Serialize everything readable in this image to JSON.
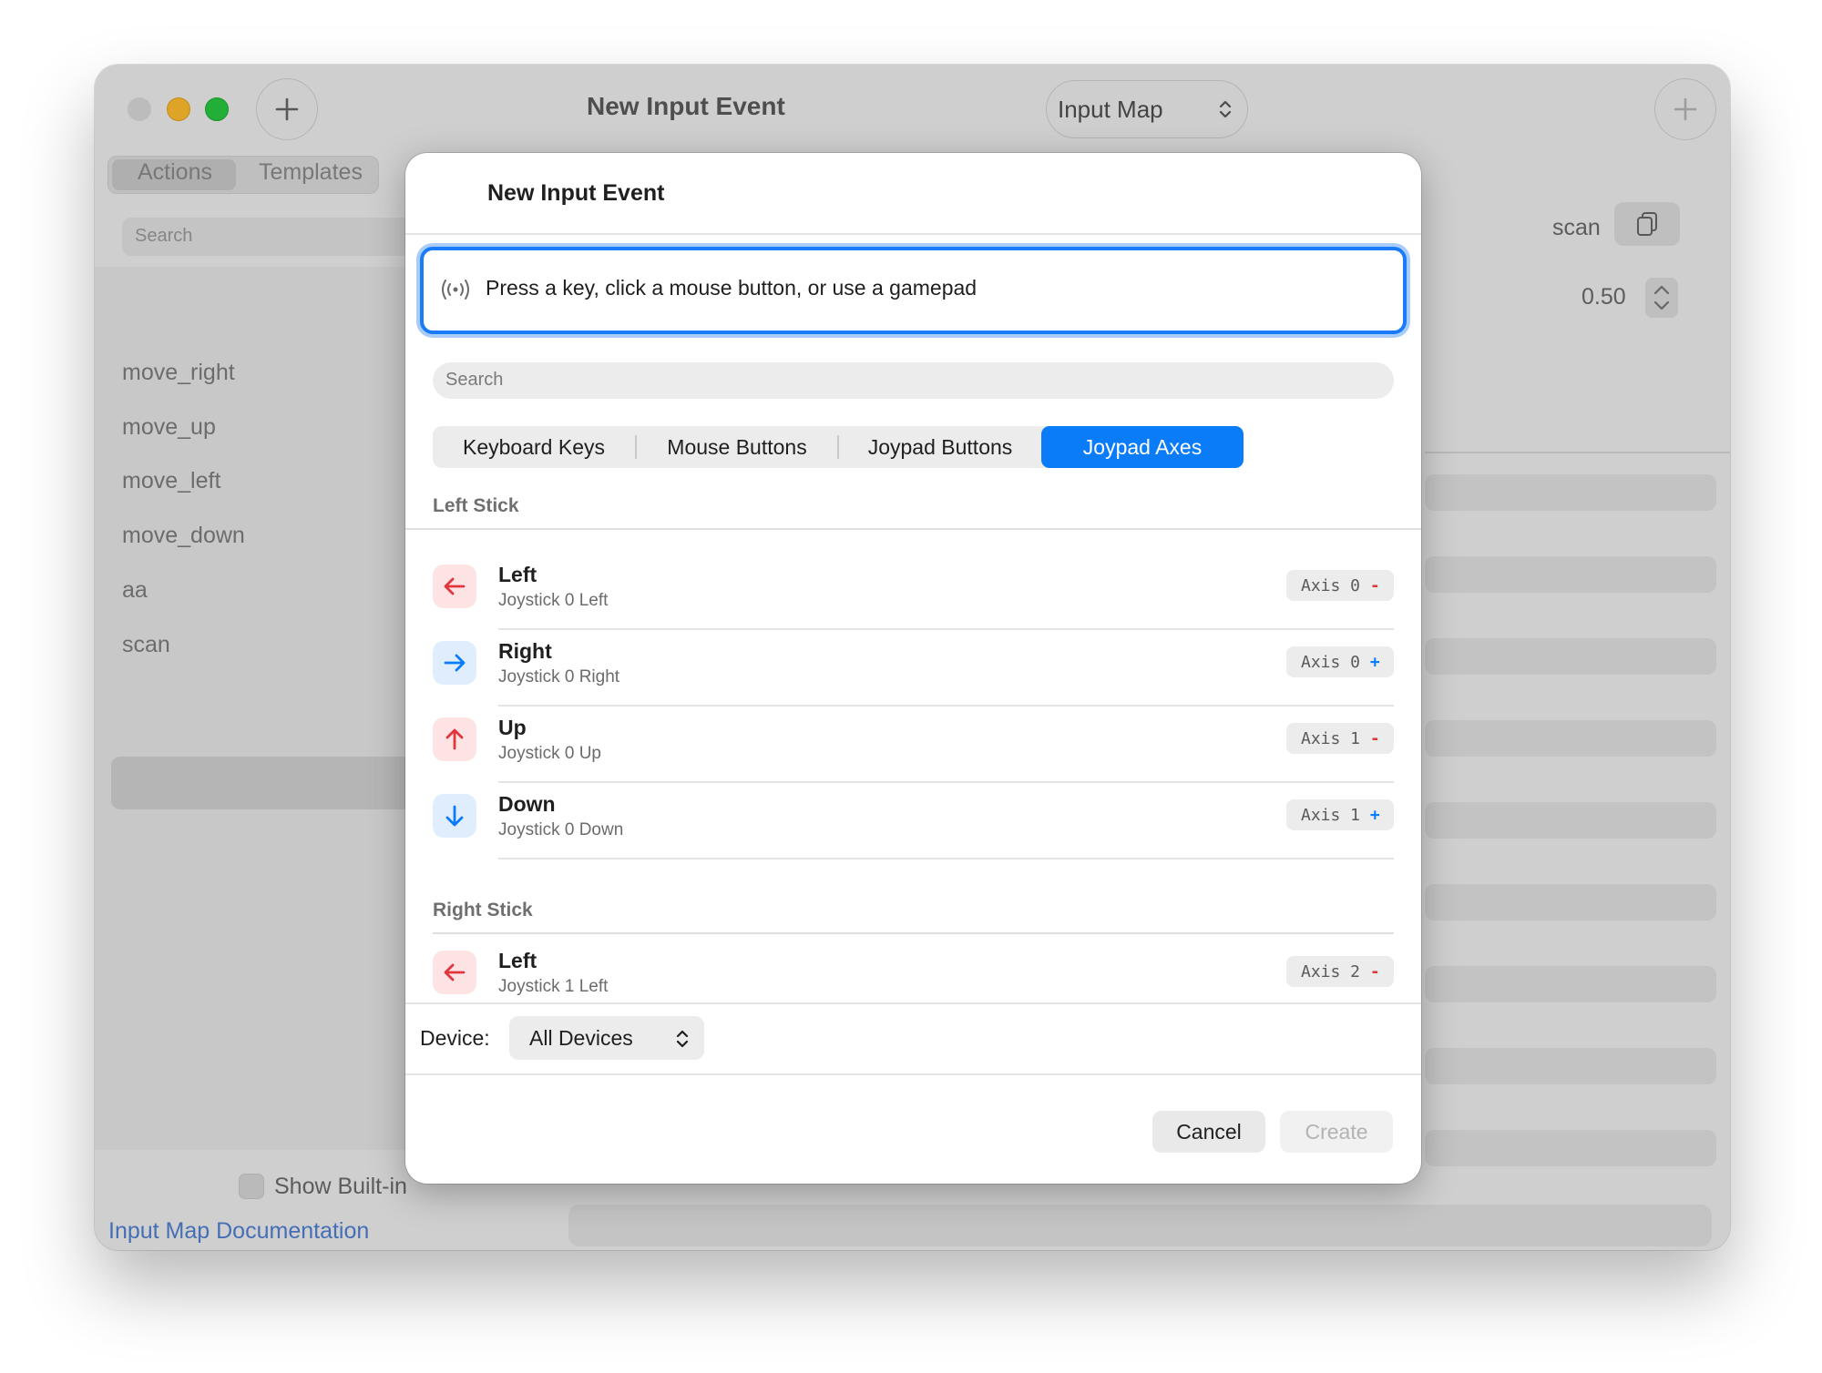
{
  "window": {
    "title": "New Input Event",
    "popup": "Input Map",
    "sidebar": {
      "tabs": [
        "Actions",
        "Templates"
      ],
      "search_placeholder": "Search",
      "items": [
        "move_right",
        "move_up",
        "move_left",
        "move_down",
        "aa",
        "scan"
      ],
      "selected": "scan",
      "show_builtin": "Show Built-in",
      "doc_link": "Input Map Documentation"
    },
    "detail": {
      "name": "scan",
      "deadzone": "0.50"
    }
  },
  "sheet": {
    "title": "New Input Event",
    "listen_prompt": "Press a key, click a mouse button, or use a gamepad",
    "search_placeholder": "Search",
    "categories": [
      "Keyboard Keys",
      "Mouse Buttons",
      "Joypad Buttons",
      "Joypad Axes"
    ],
    "active_category": "Joypad Axes",
    "sections": [
      {
        "label": "Left Stick",
        "rows": [
          {
            "title": "Left",
            "sub": "Joystick 0 Left",
            "axis": "Axis 0",
            "sign": "-",
            "icon": "arrow-left-icon"
          },
          {
            "title": "Right",
            "sub": "Joystick 0 Right",
            "axis": "Axis 0",
            "sign": "+",
            "icon": "arrow-right-icon"
          },
          {
            "title": "Up",
            "sub": "Joystick 0 Up",
            "axis": "Axis 1",
            "sign": "-",
            "icon": "arrow-up-icon"
          },
          {
            "title": "Down",
            "sub": "Joystick 0 Down",
            "axis": "Axis 1",
            "sign": "+",
            "icon": "arrow-down-icon"
          }
        ]
      },
      {
        "label": "Right Stick",
        "rows": [
          {
            "title": "Left",
            "sub": "Joystick 1 Left",
            "axis": "Axis 2",
            "sign": "-",
            "icon": "arrow-left-icon"
          }
        ]
      }
    ],
    "device_label": "Device:",
    "device_value": "All Devices",
    "cancel": "Cancel",
    "create": "Create"
  },
  "colors": {
    "accent": "#0b7cf7",
    "negative": "#e0353a",
    "link": "#4f7fd0"
  }
}
